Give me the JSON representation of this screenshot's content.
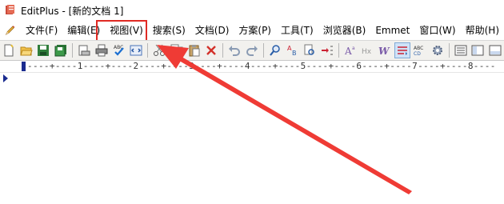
{
  "window": {
    "title": "EditPlus - [新的文档 1]",
    "app_icon": "editplus-icon"
  },
  "menu": {
    "items": [
      {
        "label": "文件(F)"
      },
      {
        "label": "编辑(E)"
      },
      {
        "label": "视图(V)"
      },
      {
        "label": "搜索(S)"
      },
      {
        "label": "文档(D)"
      },
      {
        "label": "方案(P)"
      },
      {
        "label": "工具(T)"
      },
      {
        "label": "浏览器(B)"
      },
      {
        "label": "Emmet"
      },
      {
        "label": "窗口(W)"
      },
      {
        "label": "帮助(H)"
      }
    ],
    "highlighted": "视图(V)"
  },
  "toolbar": {
    "buttons": [
      "new-file-icon",
      "open-folder-icon",
      "save-icon",
      "save-all-icon",
      "print-preview-icon",
      "print-icon",
      "spell-check-icon",
      "html-toolbar-icon",
      "cut-icon",
      "copy-icon",
      "paste-icon",
      "delete-icon",
      "undo-icon",
      "redo-icon",
      "find-icon",
      "replace-icon",
      "find-in-files-icon",
      "go-to-line-icon",
      "font-size-icon",
      "hex-icon",
      "word-wrap-icon",
      "line-number-icon",
      "column-select-icon",
      "settings-icon",
      "document-list-icon",
      "cliptext-icon",
      "output-icon"
    ]
  },
  "ruler": {
    "text": "----+----1----+----2----+----3----+----4----+----5----+----6----+----7----+----8----"
  },
  "colors": {
    "highlight": "#e02a24",
    "arrow": "#ef3b35",
    "ruler_marker": "#1a2b8f"
  }
}
